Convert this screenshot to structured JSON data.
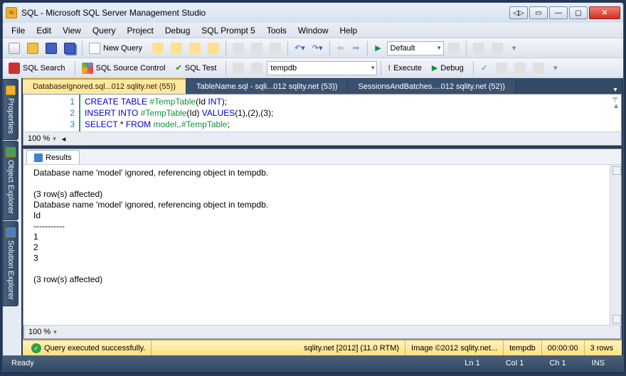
{
  "title": "SQL - Microsoft SQL Server Management Studio",
  "menu": [
    "File",
    "Edit",
    "View",
    "Query",
    "Project",
    "Debug",
    "SQL Prompt 5",
    "Tools",
    "Window",
    "Help"
  ],
  "toolbar1": {
    "new_query": "New Query",
    "config": "Default"
  },
  "toolbar2": {
    "sql_search": "SQL Search",
    "source_control": "SQL Source Control",
    "sql_test": "SQL Test",
    "db": "tempdb",
    "execute": "Execute",
    "debug": "Debug"
  },
  "side_tabs": [
    "Properties",
    "Object Explorer",
    "Solution Explorer"
  ],
  "doc_tabs": [
    {
      "label": "DatabaseIgnored.sql...012 sqlity.net (55))",
      "active": true
    },
    {
      "label": "TableName.sql - sqli...012 sqlity.net (53))",
      "active": false
    },
    {
      "label": "SessionsAndBatches....012 sqlity.net (52))",
      "active": false
    }
  ],
  "code": {
    "lines": [
      "1",
      "2",
      "3"
    ],
    "l1": {
      "a": "CREATE TABLE ",
      "b": "#TempTable",
      "c": "(",
      "d": "Id ",
      "e": "INT",
      "f": ");"
    },
    "l2": {
      "a": "INSERT INTO ",
      "b": "#TempTable",
      "c": "(",
      "d": "Id",
      "e": ") ",
      "f": "VALUES",
      "g": "(",
      "h": "1",
      "i": "),(",
      "j": "2",
      "k": "),(",
      "l": "3",
      "m": ");"
    },
    "l3": {
      "a": "SELECT ",
      "b": "* ",
      "c": "FROM ",
      "d": "model",
      "e": "..",
      "f": "#TempTable",
      "g": ";"
    }
  },
  "zoom": "100 %",
  "results_tab": "Results",
  "results_text": "Database name 'model' ignored, referencing object in tempdb.\n\n(3 row(s) affected)\nDatabase name 'model' ignored, referencing object in tempdb.\nId\n-----------\n1\n2\n3\n\n(3 row(s) affected)",
  "status": {
    "msg": "Query executed successfully.",
    "server": "sqlity.net [2012] (11.0 RTM)",
    "image": "Image ©2012 sqlity.net...",
    "db": "tempdb",
    "time": "00:00:00",
    "rows": "3 rows"
  },
  "bottom": {
    "ready": "Ready",
    "ln": "Ln 1",
    "col": "Col 1",
    "ch": "Ch 1",
    "ins": "INS"
  }
}
